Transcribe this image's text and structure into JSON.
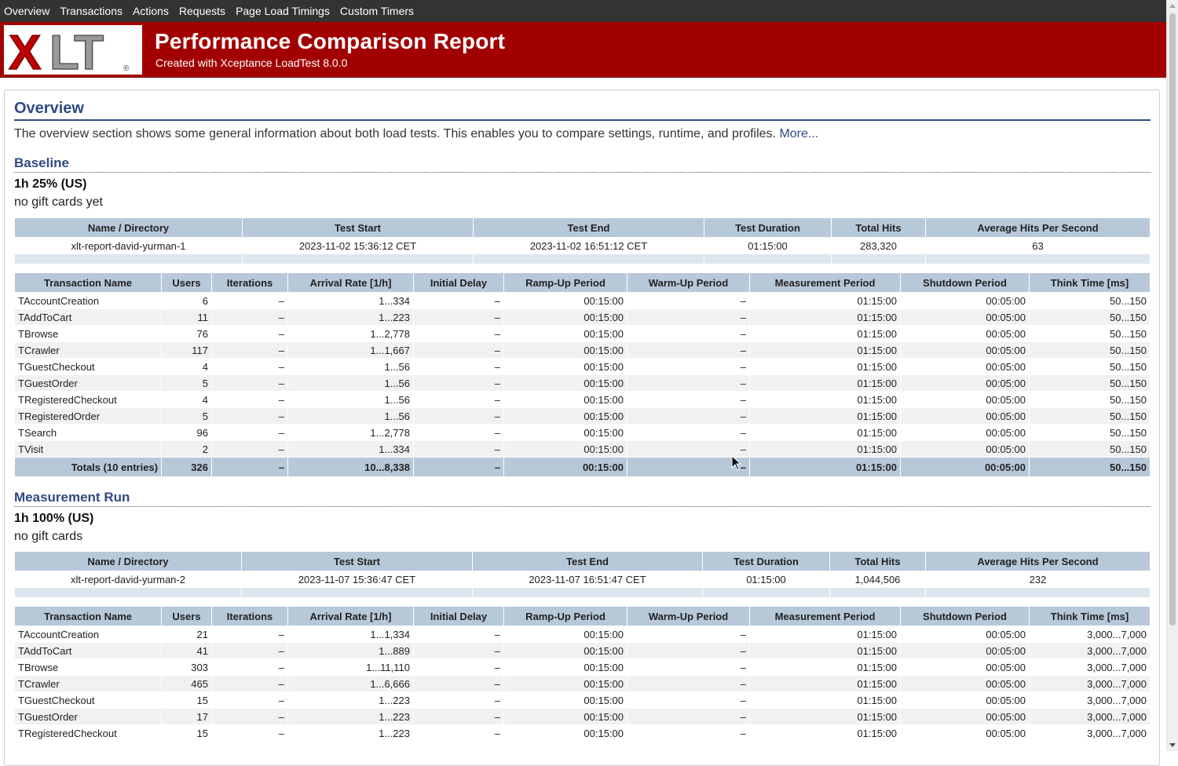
{
  "nav": [
    "Overview",
    "Transactions",
    "Actions",
    "Requests",
    "Page Load Timings",
    "Custom Timers"
  ],
  "header": {
    "logo_text": "XLT",
    "title": "Performance Comparison Report",
    "subtitle": "Created with Xceptance LoadTest 8.0.0"
  },
  "colors": {
    "nav_bg": "#333333",
    "header_bg": "#a20000",
    "heading": "#304a82",
    "table_header": "#b7c8d9"
  },
  "overview": {
    "title": "Overview",
    "description": "The overview section shows some general information about both load tests. This enables you to compare settings, runtime, and profiles. ",
    "more_link": "More..."
  },
  "summary_headers": [
    "Name / Directory",
    "Test Start",
    "Test End",
    "Test Duration",
    "Total Hits",
    "Average Hits Per Second"
  ],
  "tx_headers": [
    "Transaction Name",
    "Users",
    "Iterations",
    "Arrival Rate [1/h]",
    "Initial Delay",
    "Ramp-Up Period",
    "Warm-Up Period",
    "Measurement Period",
    "Shutdown Period",
    "Think Time [ms]"
  ],
  "baseline": {
    "title": "Baseline",
    "name": "1h 25% (US)",
    "description": "no gift cards yet",
    "summary": [
      "xlt-report-david-yurman-1",
      "2023-11-02 15:36:12 CET",
      "2023-11-02 16:51:12 CET",
      "01:15:00",
      "283,320",
      "63"
    ],
    "rows": [
      [
        "TAccountCreation",
        "6",
        "–",
        "1...334",
        "–",
        "00:15:00",
        "–",
        "01:15:00",
        "00:05:00",
        "50...150"
      ],
      [
        "TAddToCart",
        "11",
        "–",
        "1...223",
        "–",
        "00:15:00",
        "–",
        "01:15:00",
        "00:05:00",
        "50...150"
      ],
      [
        "TBrowse",
        "76",
        "–",
        "1...2,778",
        "–",
        "00:15:00",
        "–",
        "01:15:00",
        "00:05:00",
        "50...150"
      ],
      [
        "TCrawler",
        "117",
        "–",
        "1...1,667",
        "–",
        "00:15:00",
        "–",
        "01:15:00",
        "00:05:00",
        "50...150"
      ],
      [
        "TGuestCheckout",
        "4",
        "–",
        "1...56",
        "–",
        "00:15:00",
        "–",
        "01:15:00",
        "00:05:00",
        "50...150"
      ],
      [
        "TGuestOrder",
        "5",
        "–",
        "1...56",
        "–",
        "00:15:00",
        "–",
        "01:15:00",
        "00:05:00",
        "50...150"
      ],
      [
        "TRegisteredCheckout",
        "4",
        "–",
        "1...56",
        "–",
        "00:15:00",
        "–",
        "01:15:00",
        "00:05:00",
        "50...150"
      ],
      [
        "TRegisteredOrder",
        "5",
        "–",
        "1...56",
        "–",
        "00:15:00",
        "–",
        "01:15:00",
        "00:05:00",
        "50...150"
      ],
      [
        "TSearch",
        "96",
        "–",
        "1...2,778",
        "–",
        "00:15:00",
        "–",
        "01:15:00",
        "00:05:00",
        "50...150"
      ],
      [
        "TVisit",
        "2",
        "–",
        "1...334",
        "–",
        "00:15:00",
        "–",
        "01:15:00",
        "00:05:00",
        "50...150"
      ]
    ],
    "totals": [
      "Totals (10 entries)",
      "326",
      "–",
      "10...8,338",
      "–",
      "00:15:00",
      "–",
      "01:15:00",
      "00:05:00",
      "50...150"
    ]
  },
  "measurement": {
    "title": "Measurement Run",
    "name": "1h 100% (US)",
    "description": "no gift cards",
    "summary": [
      "xlt-report-david-yurman-2",
      "2023-11-07 15:36:47 CET",
      "2023-11-07 16:51:47 CET",
      "01:15:00",
      "1,044,506",
      "232"
    ],
    "rows": [
      [
        "TAccountCreation",
        "21",
        "–",
        "1...1,334",
        "–",
        "00:15:00",
        "–",
        "01:15:00",
        "00:05:00",
        "3,000...7,000"
      ],
      [
        "TAddToCart",
        "41",
        "–",
        "1...889",
        "–",
        "00:15:00",
        "–",
        "01:15:00",
        "00:05:00",
        "3,000...7,000"
      ],
      [
        "TBrowse",
        "303",
        "–",
        "1...11,110",
        "–",
        "00:15:00",
        "–",
        "01:15:00",
        "00:05:00",
        "3,000...7,000"
      ],
      [
        "TCrawler",
        "465",
        "–",
        "1...6,666",
        "–",
        "00:15:00",
        "–",
        "01:15:00",
        "00:05:00",
        "3,000...7,000"
      ],
      [
        "TGuestCheckout",
        "15",
        "–",
        "1...223",
        "–",
        "00:15:00",
        "–",
        "01:15:00",
        "00:05:00",
        "3,000...7,000"
      ],
      [
        "TGuestOrder",
        "17",
        "–",
        "1...223",
        "–",
        "00:15:00",
        "–",
        "01:15:00",
        "00:05:00",
        "3,000...7,000"
      ],
      [
        "TRegisteredCheckout",
        "15",
        "–",
        "1...223",
        "–",
        "00:15:00",
        "–",
        "01:15:00",
        "00:05:00",
        "3,000...7,000"
      ]
    ]
  }
}
